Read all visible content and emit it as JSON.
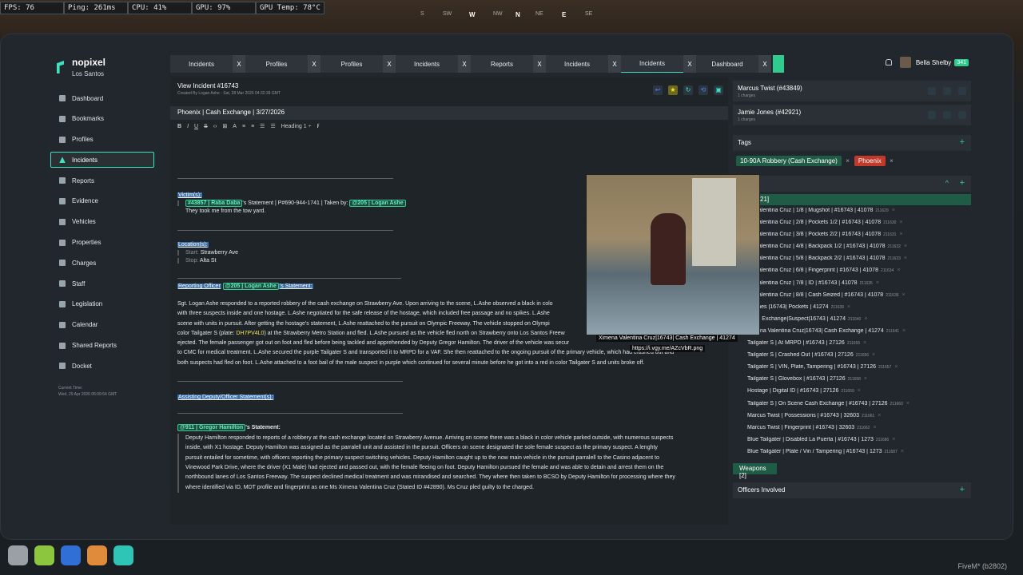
{
  "hud": {
    "fps": "FPS: 76",
    "ping": "Ping: 261ms",
    "cpu": "CPU: 41%",
    "gpu": "GPU: 97%",
    "gpu_temp": "GPU Temp: 78°C"
  },
  "compass": [
    "S",
    "SW",
    "W",
    "NW",
    "N",
    "NE",
    "E",
    "SE"
  ],
  "app": {
    "name": "nopixel",
    "city": "Los Santos"
  },
  "nav": [
    "Dashboard",
    "Bookmarks",
    "Profiles",
    "Incidents",
    "Reports",
    "Evidence",
    "Vehicles",
    "Properties",
    "Charges",
    "Staff",
    "Legislation",
    "Calendar",
    "Shared Reports",
    "Docket"
  ],
  "current_time": {
    "label": "Current Time:",
    "value": "Wed, 29 Apr 2026 06:09:54 GMT"
  },
  "tabs": [
    "Incidents",
    "Profiles",
    "Profiles",
    "Incidents",
    "Reports",
    "Incidents",
    "Incidents",
    "Dashboard"
  ],
  "tab_close": "X",
  "user": {
    "name": "Bella Shelby",
    "badge": "341"
  },
  "incident": {
    "title": "View Incident #16743",
    "subtitle": "Created By Logan Ashe - Sat, 28 Mar 2026 04:32:39 GMT",
    "name": "Phoenix | Cash Exchange | 3/27/2026"
  },
  "toolbar": {
    "bold": "B",
    "italic": "I",
    "underline": "U",
    "strike": "S",
    "heading": "Heading 1 ÷",
    "clear": "I̸"
  },
  "report": {
    "victims_h": "Victim(s):",
    "victim_mention": "#43857 | Raba Daba",
    "victim_rest": "'s Statement | P#690-944-1741 | Taken by:",
    "victim_taker": "@205 | Logan Ashe",
    "victim_quote": "They took me from the tow yard.",
    "location_h": "Location(s):",
    "start": "Start:",
    "start_v": "Strawberry Ave",
    "stop": "Stop:",
    "stop_v": "Alta St",
    "ro_h1": "Reporting Officer",
    "ro_mention": "@205 | Logan Ashe",
    "ro_h2": "'s Statement:",
    "p1a": "Sgt. Logan Ashe responded to a reported robbery of the cash exchange on Strawberry Ave. Upon arriving to the scene, L.Ashe observed a black in colo",
    "p1b": "with three suspects inside and one hostage. L.Ashe negotiated for the safe release of the hostage, which included free passage and no spikes. L.Ashe",
    "p1c": "scene with units in pursuit. After getting the hostage's statement, L.Ashe reattached to the pursuit on Olympic Freeway. The vehicle stopped on Olympi",
    "p1d1": "color Tailgater S (plate: ",
    "p1d_plate": "DH7PV4L0",
    "p1d2": ") at the Strawberry Metro Station and fled. L.Ashe pursued as the vehicle fled north on Strawberry onto Los Santos Freew",
    "p1e": "ejected. The female passenger got out on foot and fled before being tackled and apprehended by Deputy Gregor Hamilton. The driver of the vehicle was secur",
    "p1f": "to CMC for medical treatment. L.Ashe secured the purple Tailgater S and transported it to MRPD for a VAF. She then reattached to the ongoing pursuit of the primary vehicle, which had crashed out and",
    "p1g": "both suspects had fled on foot. L.Ashe attached to a foot bail of the male suspect in purple which continued for several minute before he got into a red in color Tailgater S and units broke off.",
    "assist_h": "Assisting Deputy/Officer Statement(s):",
    "dep_mention": "@911 | Gregor Hamilton",
    "dep_rest": "'s Statement:",
    "p2a": "Deputy Hamilton responded to reports of a robbery at the cash exchange located on Strawberry Avenue. Arriving on scene there was a black in color vehicle parked outside, with numerous suspects",
    "p2b": "inside, with X1 hostage. Deputy Hamilton was assigned as the parralell unit and assisted in the pursuit. Officers on scene designated the sole female suspect as the primary suspect. A lenghty",
    "p2c": "pursuit entailed for sometime, with officers reporting the primary suspect switching vehicles. Deputy Hamilton caught up to the now main vehicle in the pursuit parralell to the Casino adjacent to",
    "p2d": "Vinewood Park Drive, where the driver (X1 Male) had ejected and passed out, with the female fleeing on foot. Deputy Hamilton pursued the female and was able to detain and arrest them on the",
    "p2e": "northbound lanes of Los Santos Freeway. The suspect declined medical treatment and was mirandised and searched. They where then taken to BCSO by Deputy Hamilton for processing where they",
    "p2f": "where identified via ID, MDT profile and fingerprint as one Ms Ximena Valentina Cruz (Stated ID #42890). Ms Cruz pled guilty to the charged."
  },
  "people": [
    {
      "name": "Marcus Twist (#43849)",
      "charges": "1 charges"
    },
    {
      "name": "Jamie Jones (#42921)",
      "charges": "1 charges"
    }
  ],
  "tags_h": "Tags",
  "tags": [
    {
      "label": "10-90A Robbery (Cash Exchange)",
      "color": "#1f5c46"
    },
    {
      "label": "Phoenix",
      "color": "#c0392b"
    }
  ],
  "evidence_count": "21]",
  "evidence": [
    [
      "na Valentina Cruz | 1/8 | Mugshot | #16743 | 41078",
      "211629"
    ],
    [
      "na Valentina Cruz | 2/8 | Pockets 1/2 | #16743 | 41078",
      "211630"
    ],
    [
      "na Valentina Cruz | 3/8 | Pockets 2/2 | #16743 | 41078",
      "211631"
    ],
    [
      "na Valentina Cruz | 4/8 | Backpack 1/2 | #16743 | 41078",
      "211632"
    ],
    [
      "na Valentina Cruz | 5/8 | Backpack 2/2 | #16743 | 41078",
      "211633"
    ],
    [
      "na Valentina Cruz | 6/8 | Fingerprint | #16743 | 41078",
      "211634"
    ],
    [
      "na Valentina Cruz | 7/8 | ID | #16743 | 41078",
      "211635"
    ],
    [
      "na Valentina Cruz | 8/8 | Cash Seized | #16743 | 41078",
      "211636"
    ],
    [
      "e Jones |16743| Pockets | 41274",
      "211639"
    ],
    [
      "Cash Exchange|Suspect|16743 | 41274",
      "211640"
    ],
    [
      "Ximena Valentina Cruz|16743| Cash Exchange | 41274",
      "211641"
    ],
    [
      "Tailgater S | At MRPD | #16743 | 27126",
      "211655"
    ],
    [
      "Tailgater S | Crashed Out | #16743 | 27126",
      "211656"
    ],
    [
      "Tailgater S | VIN, Plate, Tampering | #16743 | 27126",
      "211657"
    ],
    [
      "Tailgater S | Glovebox | #16743 | 27126",
      "211658"
    ],
    [
      "Hostage | Digital ID | #16743 | 27126",
      "211659"
    ],
    [
      "Tailgater S | On Scene Cash Exchange | #16743 | 27126",
      "211660"
    ],
    [
      "Marcus Twist | Possessions | #16743 | 32603",
      "211661"
    ],
    [
      "Marcus Twist | Fingerprint | #16743 | 32603",
      "211662"
    ],
    [
      "Blue Tailgater | Disabled La Puerta | #16743 | 1273",
      "211686"
    ],
    [
      "Blue Tailgater | Plate / Vin / Tampering | #16743 | 1273",
      "211687"
    ]
  ],
  "weapons": "Weapons [2]",
  "officers_h": "Officers Involved",
  "tooltip": {
    "name": "Ximena Valentina Cruz|16743| Cash Exchange | 41274",
    "url": "https://i.vgy.me/AZcVbR.png"
  },
  "footer": "FiveM* (b2802)",
  "colors": {
    "accent": "#3be3c1",
    "green": "#2ecc8f"
  }
}
